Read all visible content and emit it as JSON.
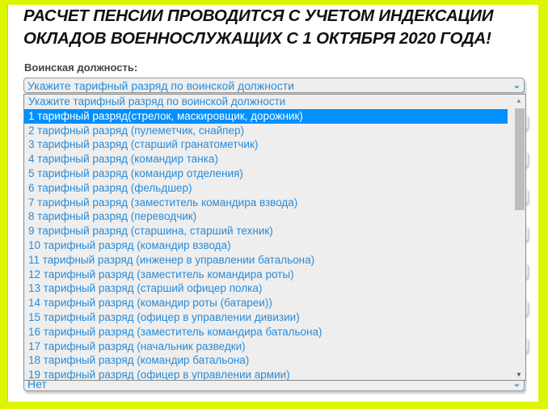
{
  "title_line1": "РАСЧЕТ ПЕНСИИ ПРОВОДИТСЯ С УЧЕТОМ ИНДЕКСАЦИИ",
  "title_line2": "ОКЛАДОВ ВОЕННОСЛУЖАЩИХ С 1 ОКТЯБРЯ 2020 ГОДА!",
  "position_label": "Воинская должность:",
  "position_select_value": "Укажите тарифный разряд по воинской должности",
  "bottom_select_value": "Нет",
  "options": [
    "Укажите тарифный разряд по воинской должности",
    "1 тарифный разряд(стрелок, маскировщик, дорожник)",
    "2 тарифный разряд (пулеметчик, снайпер)",
    "3 тарифный разряд (старший гранатометчик)",
    "4 тарифный разряд (командир танка)",
    "5 тарифный разряд (командир отделения)",
    "6 тарифный разряд (фельдшер)",
    "7 тарифный разряд (заместитель командира взвода)",
    "8 тарифный разряд (переводчик)",
    "9 тарифный разряд (старшина, старший техник)",
    "10 тарифный разряд (командир взвода)",
    "11 тарифный разряд (инженер в управлении батальона)",
    "12 тарифный разряд (заместитель командира роты)",
    "13 тарифный разряд (старший офицер полка)",
    "14 тарифный разряд (командир роты (батареи))",
    "15 тарифный разряд (офицер в управлении дивизии)",
    "16 тарифный разряд (заместитель командира батальона)",
    "17 тарифный разряд (начальник разведки)",
    "18 тарифный разряд (командир батальона)",
    "19 тарифный разряд (офицер в управлении армии)"
  ],
  "highlighted_index": 1
}
